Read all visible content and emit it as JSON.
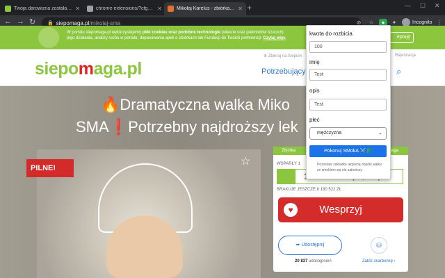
{
  "browser": {
    "tabs": [
      {
        "title": "Twoja darowizna została przekaz",
        "active": false
      },
      {
        "title": "chrome-extensions/?cfgmoaipau",
        "active": false
      },
      {
        "title": "Mikołaj Karelus - zbiórka charyt",
        "active": true
      }
    ],
    "url_host": "siepomaga.pl",
    "url_path": "/mikolaj-sma",
    "profile_label": "Incognito"
  },
  "cookie_banner": {
    "line1_pre": "W portalu siepomaga.pl wykorzystujemy ",
    "line1_bold": "pliki cookies oraz podobne technologie",
    "line1_post": " (własne oraz podmiotów trzecich)",
    "line2_pre": "jego działania, analizy ruchu w portalu, dopasowania apeli o zbiórkach lub Fundacji do Twoich preferencji. ",
    "line2_link": "Czytaj więc",
    "accept_label": "eptuję"
  },
  "header": {
    "brand_a": "siepo",
    "brand_b": "m",
    "brand_c": "aga.pl",
    "mini_left": "⊕ Zbieraj na Siepom",
    "mini_right": "Rejestracja",
    "nav_link": "Potrzebujący"
  },
  "hero": {
    "title_line1": "🔥Dramatyczna walka Miko",
    "title_line2": "SMA❗Potrzebny najdroższy lek",
    "badge": "PILNE!"
  },
  "card": {
    "head_left": "Zbiórka",
    "head_right": "maga",
    "supporters_label": "WSPARŁY 1",
    "amount": "1 393 947 zł",
    "percent_text": "(14,55%)",
    "progress_pct": 14.55,
    "remaining": "BRAKUJE JESZCZE 8 180 522 ZŁ",
    "donate_label": "Wesprzyj",
    "share_label": "Udostępnij",
    "shared_count": "20 837",
    "shared_suffix": " udostępnień",
    "piggy_link": "Załóż skarbonkę ›"
  },
  "popup": {
    "amount_label": "kwota do rozbicia",
    "amount_value": "100",
    "name_label": "imię",
    "name_value": "Test",
    "desc_label": "opis",
    "desc_value": "Test",
    "gender_label": "płeć",
    "gender_value": "mężczyzna",
    "button_label": "Pokonuj SMokA ⚔️🐉",
    "note": "Pozostaw zakładkę aktywną dopóki walka ze smokiem się nie zakończy."
  },
  "colors": {
    "green": "#8cc63e",
    "red": "#d42b2b",
    "blue": "#2878c8",
    "button_blue": "#1a73e8"
  }
}
